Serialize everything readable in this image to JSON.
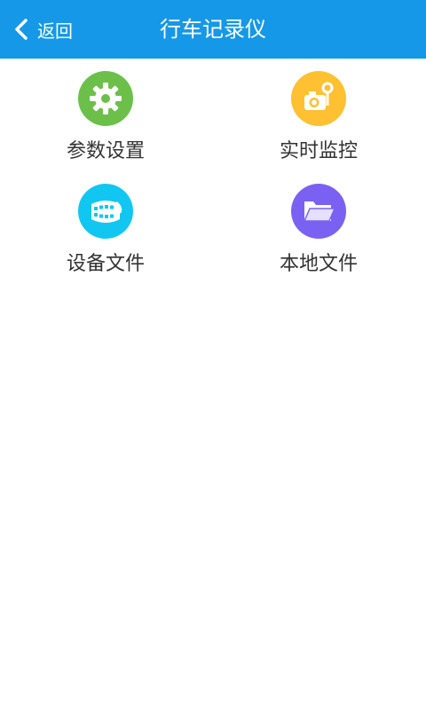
{
  "header": {
    "back_label": "返回",
    "title": "行车记录仪",
    "background": "#1598e7"
  },
  "menu": [
    {
      "label": "参数设置",
      "icon": "gear-icon",
      "color": "#6cc04a"
    },
    {
      "label": "实时监控",
      "icon": "camera-icon",
      "color": "#ffc132"
    },
    {
      "label": "设备文件",
      "icon": "film-reel-icon",
      "color": "#12c6f2"
    },
    {
      "label": "本地文件",
      "icon": "folder-icon",
      "color": "#7b61f2"
    }
  ]
}
